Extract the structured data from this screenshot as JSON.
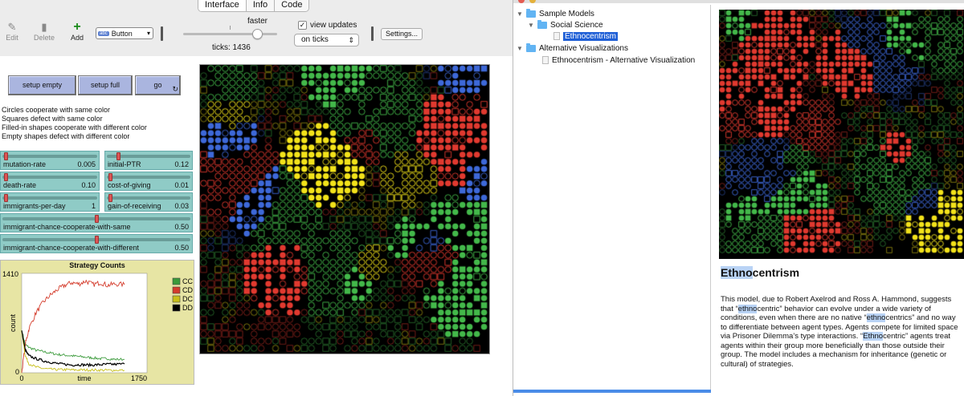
{
  "tabs": [
    "Interface",
    "Info",
    "Code"
  ],
  "toolbar": {
    "edit_label": "Edit",
    "delete_label": "Delete",
    "add_label": "Add",
    "widget_type": "Button",
    "widget_badge": "abc",
    "speed_label": "faster",
    "ticks_text": "ticks: 1436",
    "view_updates_label": "view updates",
    "view_updates_checked": true,
    "update_mode": "on ticks",
    "settings_label": "Settings..."
  },
  "buttons": {
    "setup_empty": "setup empty",
    "setup_full": "setup full",
    "go": "go"
  },
  "notes": [
    "Circles cooperate with same color",
    "Squares defect with same color",
    "Filled-in shapes cooperate with different color",
    "Empty shapes defect with different color"
  ],
  "sliders": [
    {
      "name": "mutation-rate",
      "value": "0.005",
      "level": 0.02
    },
    {
      "name": "initial-PTR",
      "value": "0.12",
      "level": 0.12
    },
    {
      "name": "death-rate",
      "value": "0.10",
      "level": 0.02
    },
    {
      "name": "cost-of-giving",
      "value": "0.01",
      "level": 0.02
    },
    {
      "name": "immigrants-per-day",
      "value": "1",
      "level": 0.02
    },
    {
      "name": "gain-of-receiving",
      "value": "0.03",
      "level": 0.02
    },
    {
      "name": "immigrant-chance-cooperate-with-same",
      "value": "0.50",
      "level": 0.5
    },
    {
      "name": "immigrant-chance-cooperate-with-different",
      "value": "0.50",
      "level": 0.5
    }
  ],
  "plot": {
    "title": "Strategy Counts",
    "ylabel": "count",
    "xlabel": "time",
    "y_max_label": "1410",
    "y_min_label": "0",
    "x_min_label": "0",
    "x_max_label": "1750",
    "legend": [
      {
        "name": "CC",
        "color": "#3a9a3a"
      },
      {
        "name": "CD",
        "color": "#d43c2c"
      },
      {
        "name": "DC",
        "color": "#c8c01a"
      },
      {
        "name": "DD",
        "color": "#000000"
      }
    ]
  },
  "chart_data": {
    "type": "line",
    "title": "Strategy Counts",
    "xlabel": "time",
    "ylabel": "count",
    "xlim": [
      0,
      1750
    ],
    "ylim": [
      0,
      1410
    ],
    "series": [
      {
        "name": "CC",
        "color": "#3a9a3a",
        "x": [
          0,
          50,
          100,
          200,
          300,
          400,
          500,
          600,
          700,
          800,
          900,
          1000,
          1100,
          1200,
          1300,
          1436
        ],
        "y": [
          600,
          400,
          360,
          320,
          300,
          280,
          260,
          250,
          240,
          230,
          220,
          210,
          200,
          200,
          190,
          190
        ]
      },
      {
        "name": "CD",
        "color": "#d43c2c",
        "x": [
          0,
          50,
          100,
          200,
          300,
          400,
          500,
          600,
          700,
          800,
          900,
          1000,
          1100,
          1200,
          1300,
          1436
        ],
        "y": [
          0,
          400,
          620,
          850,
          1000,
          1100,
          1180,
          1240,
          1280,
          1260,
          1300,
          1250,
          1280,
          1240,
          1260,
          1250
        ]
      },
      {
        "name": "DC",
        "color": "#c8c01a",
        "x": [
          0,
          50,
          100,
          200,
          300,
          400,
          500,
          600,
          700,
          800,
          900,
          1000,
          1100,
          1200,
          1300,
          1436
        ],
        "y": [
          600,
          240,
          130,
          80,
          60,
          50,
          45,
          45,
          40,
          40,
          40,
          38,
          38,
          36,
          36,
          35
        ]
      },
      {
        "name": "DD",
        "color": "#000000",
        "x": [
          0,
          50,
          100,
          200,
          300,
          400,
          500,
          600,
          700,
          800,
          900,
          1000,
          1100,
          1200,
          1300,
          1436
        ],
        "y": [
          600,
          320,
          240,
          200,
          170,
          150,
          130,
          120,
          110,
          115,
          110,
          110,
          115,
          120,
          120,
          125
        ]
      }
    ]
  },
  "library": {
    "tree": [
      {
        "label": "Sample Models",
        "kind": "folder",
        "expanded": true
      },
      {
        "label": "Social Science",
        "kind": "folder",
        "expanded": true
      },
      {
        "label": "Ethnocentrism",
        "kind": "file",
        "selected": true
      },
      {
        "label": "Alternative Visualizations",
        "kind": "folder",
        "expanded": true
      },
      {
        "label": "Ethnocentrism - Alternative Visualization",
        "kind": "file",
        "selected": false
      }
    ],
    "title_hl": "Ethno",
    "title_rest": "centrism",
    "description": [
      {
        "t": "This model, due to Robert Axelrod and Ross A. Hammond, suggests that “"
      },
      {
        "t": "ethno",
        "hl": true
      },
      {
        "t": "centric” behavior can evolve under a wide variety of conditions, even when there are no native “"
      },
      {
        "t": "ethno",
        "hl": true
      },
      {
        "t": "centrics” and no way to differentiate between agent types. Agents compete for limited space via Prisoner Dilemma’s type interactions. “"
      },
      {
        "t": "Ethno",
        "hl": true
      },
      {
        "t": "centric” agents treat agents within their group more beneficially than those outside their group. The model includes a mechanism for inheritance (genetic or cultural) of strategies."
      }
    ]
  }
}
